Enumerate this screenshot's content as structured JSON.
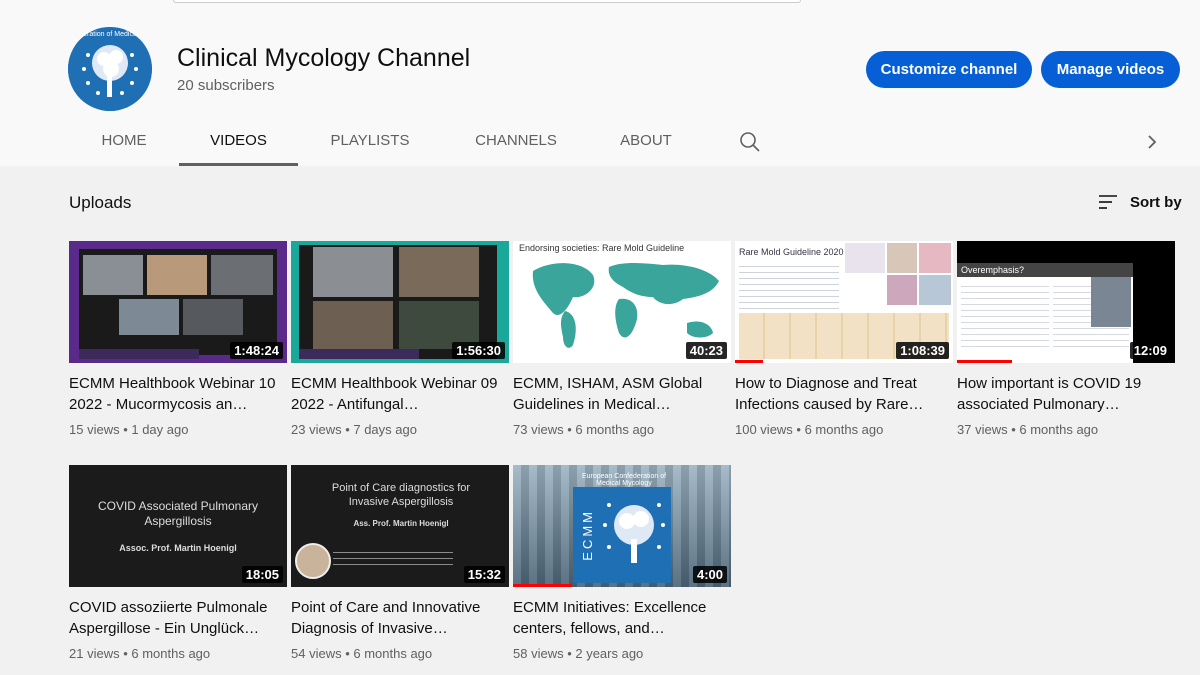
{
  "channel": {
    "name": "Clinical Mycology Channel",
    "subscribers": "20 subscribers",
    "avatar_text": "Confederation of Medical Mycology"
  },
  "buttons": {
    "customize": "Customize channel",
    "manage": "Manage videos"
  },
  "tabs": [
    {
      "label": "HOME",
      "active": false
    },
    {
      "label": "VIDEOS",
      "active": true
    },
    {
      "label": "PLAYLISTS",
      "active": false
    },
    {
      "label": "CHANNELS",
      "active": false
    },
    {
      "label": "ABOUT",
      "active": false
    }
  ],
  "section": {
    "title": "Uploads",
    "sort_label": "Sort by"
  },
  "colors": {
    "accent_button": "#065fd4",
    "progress": "#ff0000",
    "ecmm_blue": "#1f6fb5"
  },
  "videos": [
    {
      "title": "ECMM Healthbook Webinar 10 2022 - Mucormycosis an…",
      "views": "15 views",
      "age": "1 day ago",
      "duration": "1:48:24",
      "thumb_type": "video-call",
      "progress": 0
    },
    {
      "title": "ECMM Healthbook Webinar 09 2022 - Antifungal…",
      "views": "23 views",
      "age": "7 days ago",
      "duration": "1:56:30",
      "thumb_type": "video-call",
      "progress": 0
    },
    {
      "title": "ECMM, ISHAM, ASM Global Guidelines in Medical…",
      "views": "73 views",
      "age": "6 months ago",
      "duration": "40:23",
      "thumb_type": "world-map",
      "thumb_text": "Endorsing societies: Rare Mold Guideline",
      "progress": 0
    },
    {
      "title": "How to Diagnose and Treat Infections caused by Rare…",
      "views": "100 views",
      "age": "6 months ago",
      "duration": "1:08:39",
      "thumb_type": "slide-guideline",
      "thumb_text": "Rare Mold Guideline 2020",
      "progress": 0.13
    },
    {
      "title": "How important is COVID 19 associated Pulmonary…",
      "views": "37 views",
      "age": "6 months ago",
      "duration": "12:09",
      "thumb_type": "slide-overemphasis",
      "thumb_text": "Overemphasis?",
      "progress": 0.25
    },
    {
      "title": "COVID assoziierte Pulmonale Aspergillose - Ein Unglück…",
      "views": "21 views",
      "age": "6 months ago",
      "duration": "18:05",
      "thumb_type": "dark-title",
      "thumb_text": "COVID Associated Pulmonary Aspergillosis",
      "thumb_sub": "Assoc. Prof. Martin Hoenigl",
      "progress": 0
    },
    {
      "title": "Point of Care and Innovative Diagnosis of Invasive…",
      "views": "54 views",
      "age": "6 months ago",
      "duration": "15:32",
      "thumb_type": "dark-title-face",
      "thumb_text": "Point of Care diagnostics for Invasive Aspergillosis",
      "thumb_sub": "Ass. Prof. Martin Hoenigl",
      "progress": 0
    },
    {
      "title": "ECMM Initiatives: Excellence centers, fellows, and…",
      "views": "58 views",
      "age": "2 years ago",
      "duration": "4:00",
      "thumb_type": "ecmm-building",
      "thumb_text": "European Confederation of Medical Mycology",
      "thumb_logo": "ECMM",
      "progress": 0.27
    }
  ]
}
